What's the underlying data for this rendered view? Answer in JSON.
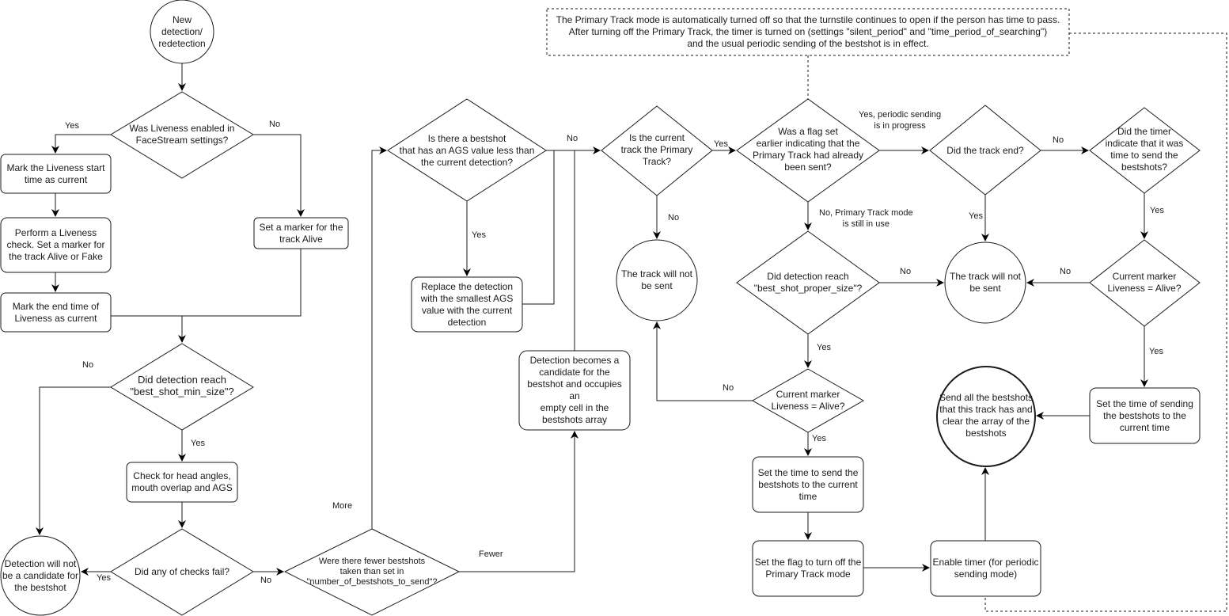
{
  "diagram": {
    "type": "flowchart",
    "nodes": {
      "start": "New\ndetection/\nredetection",
      "q_liveness_enabled": "Was Liveness enabled in\nFaceStream settings?",
      "mark_liveness_start": "Mark the Liveness start\ntime as current",
      "perform_liveness": "Perform a Liveness\ncheck. Set a marker for\nthe track Alive or Fake",
      "mark_liveness_end": "Mark the end time of\nLiveness as current",
      "set_marker_alive": "Set a marker for the\ntrack Alive",
      "q_min_size": "Did detection reach\n\"best_shot_min_size\"?",
      "check_head_angles": "Check for head angles,\nmouth overlap and AGS",
      "q_checks_fail": "Did any of checks fail?",
      "not_candidate": "Detection will not\nbe a candidate for\nthe bestshot",
      "q_fewer_bestshots": "Were there fewer bestshots\ntaken than set in\n\"number_of_bestshots_to_send\"?",
      "q_ags_less": "Is there a bestshot\nthat has an AGS value less than\nthe current detection?",
      "replace_detection": "Replace the detection\nwith the smallest AGS\nvalue with the current\ndetection",
      "becomes_candidate": "Detection becomes a\ncandidate for the\nbestshot and occupies an\nempty cell in the\nbestshots array",
      "q_primary_track": "Is the current\ntrack the Primary\nTrack?",
      "track_not_sent_1": "The track will not\nbe sent",
      "q_flag_set": "Was a flag set\nearlier indicating that the\nPrimary Track had already\nbeen sent?",
      "q_proper_size": "Did detection reach\n\"best_shot_proper_size\"?",
      "q_marker_alive_1": "Current marker\nLiveness = Alive?",
      "set_time_send": "Set the time to send the\nbestshots to the current\ntime",
      "set_flag_off": "Set the flag to turn off the\nPrimary Track mode",
      "enable_timer": "Enable timer (for periodic\nsending mode)",
      "q_track_end": "Did the track end?",
      "track_not_sent_2": "The track will not\nbe sent",
      "q_timer_indicate": "Did the timer\nindicate that it was\ntime to send the\nbestshots?",
      "q_marker_alive_2": "Current marker\nLiveness = Alive?",
      "set_time_sending": "Set the time of sending\nthe bestshots to the\ncurrent time",
      "send_all": "Send all the bestshots\nthat this track has and\nclear the array of the\nbestshots",
      "note": "The Primary Track mode is automatically turned off so that the turnstile continues to open if the person has time to pass.\nAfter turning off the Primary Track, the timer is turned on (settings \"silent_period\" and \"time_period_of_searching\")\nand the usual periodic sending of the bestshot is in effect."
    },
    "edge_labels": {
      "liveness_yes": "Yes",
      "liveness_no": "No",
      "min_size_no": "No",
      "min_size_yes": "Yes",
      "checks_yes": "Yes",
      "checks_no": "No",
      "more": "More",
      "fewer": "Fewer",
      "ags_yes": "Yes",
      "ags_no": "No",
      "primary_yes": "Yes",
      "primary_no": "No",
      "flag_yes": "Yes, periodic sending\nis in progress",
      "flag_no": "No, Primary Track mode\nis still in use",
      "proper_no": "No",
      "proper_yes": "Yes",
      "alive1_no": "No",
      "alive1_yes": "Yes",
      "track_end_no": "No",
      "track_end_yes": "Yes",
      "timer_yes": "Yes",
      "alive2_no": "No",
      "alive2_yes": "Yes"
    }
  }
}
